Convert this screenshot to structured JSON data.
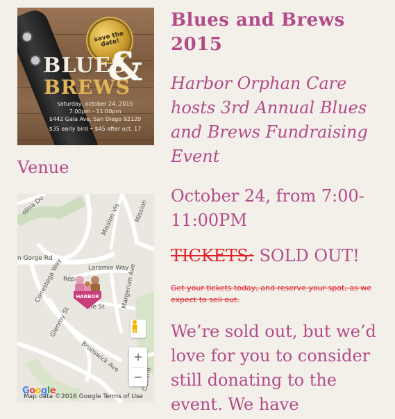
{
  "flyer": {
    "cap_text": "save the date!",
    "blues": "BLUES",
    "amp": "&",
    "brews": "BREWS",
    "line1": "saturday, october 24, 2015",
    "line2": "7:00pm - 11:00pm",
    "line3": "$442 Gala Ave, San Diego 92120",
    "line4": "$35 early bird • $45 after oct. 17"
  },
  "venue": {
    "heading": "Venue"
  },
  "map": {
    "labels": {
      "colina": "olina Do",
      "mission_vista": "Mission Vis",
      "mission_gorge": "Mission",
      "gorge_rd": "n Gorge Rd",
      "laramie": "Laramie Way",
      "conestoga": "Conestoga Way",
      "repa": "Repa",
      "margerum": "Margerum Ave",
      "sheridan": "ine St",
      "glenroy": "Glenroy St",
      "brunswick": "Brunswick Ave",
      "camino": "Camino"
    },
    "marker_label": "HARBOR",
    "zoom_in": "+",
    "zoom_out": "−",
    "attribution": "Map data ©2016 Google   Terms of Use",
    "google": "Google"
  },
  "event": {
    "title": "Blues and Brews 2015",
    "subtitle": "Harbor Orphan Care hosts 3rd Annual Blues and Brews Fundraising Event",
    "date_line": "October 24, from 7:00-11:00PM",
    "tickets_label": "TICKETS:",
    "tickets_status": " SOLD OUT!",
    "old_note": "Get your tickets today, and reserve your spot, as we expect to sell out.",
    "body": "We’re sold out, but we’d love for you to consider still donating to the event. We have"
  },
  "colors": {
    "accent": "#b34b8a",
    "strike_red": "#e0222a",
    "background": "#f4f1ea"
  }
}
